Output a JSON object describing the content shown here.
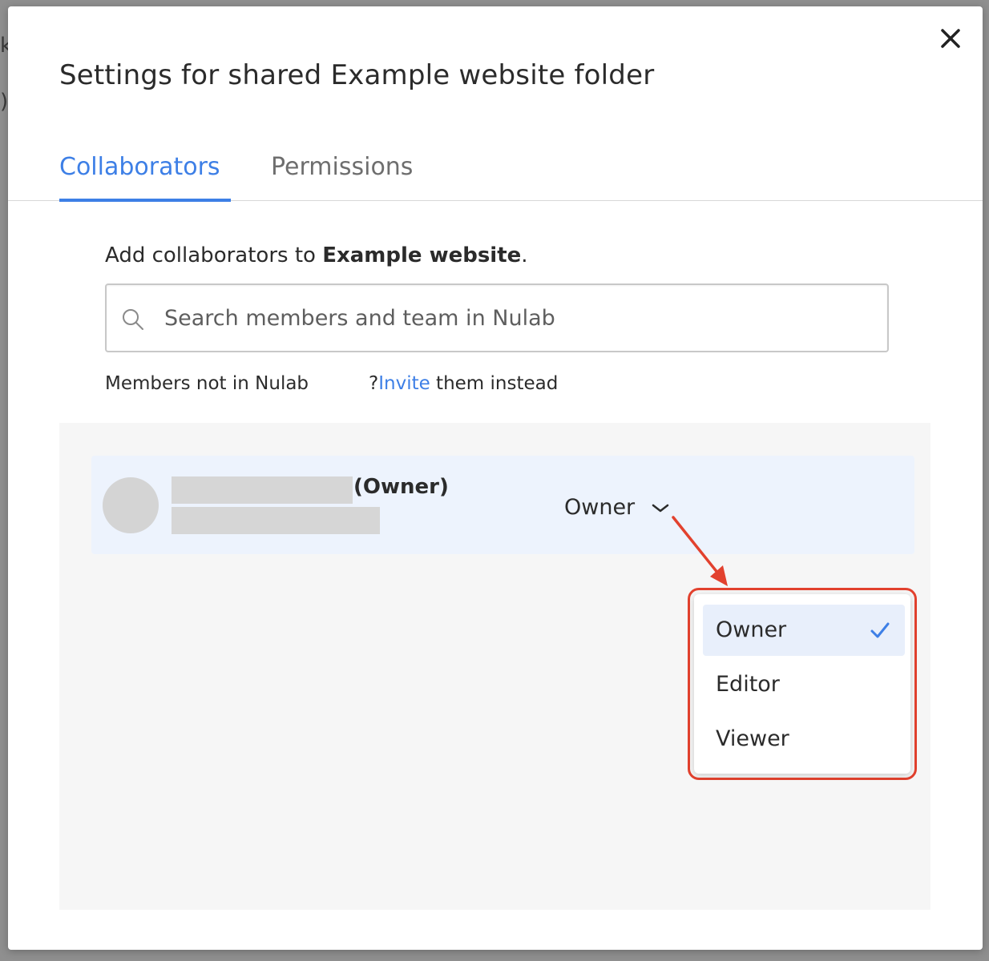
{
  "dialog": {
    "title": "Settings for shared Example website folder"
  },
  "tabs": [
    {
      "label": "Collaborators",
      "active": true
    },
    {
      "label": "Permissions",
      "active": false
    }
  ],
  "add_collaborators": {
    "prefix": "Add collaborators to ",
    "folder_name": "Example website",
    "suffix": "."
  },
  "search": {
    "placeholder": "Search members and team in Nulab",
    "value": ""
  },
  "members_note": {
    "text": "Members not in Nulab",
    "question_mark": "?",
    "invite_link": "Invite",
    "invite_suffix": " them instead"
  },
  "collaborators": [
    {
      "name_tag": "(Owner)",
      "role": "Owner"
    }
  ],
  "role_options": [
    {
      "label": "Owner",
      "selected": true
    },
    {
      "label": "Editor",
      "selected": false
    },
    {
      "label": "Viewer",
      "selected": false
    }
  ],
  "colors": {
    "accent": "#3d7fe6",
    "highlight": "#e2412e",
    "row_bg": "#edf3fd",
    "selected_option_bg": "#e8effb"
  },
  "icons": {
    "close": "close-icon",
    "search": "search-icon",
    "chevron": "chevron-down-icon",
    "check": "check-icon",
    "arrow": "annotation-arrow-icon"
  }
}
